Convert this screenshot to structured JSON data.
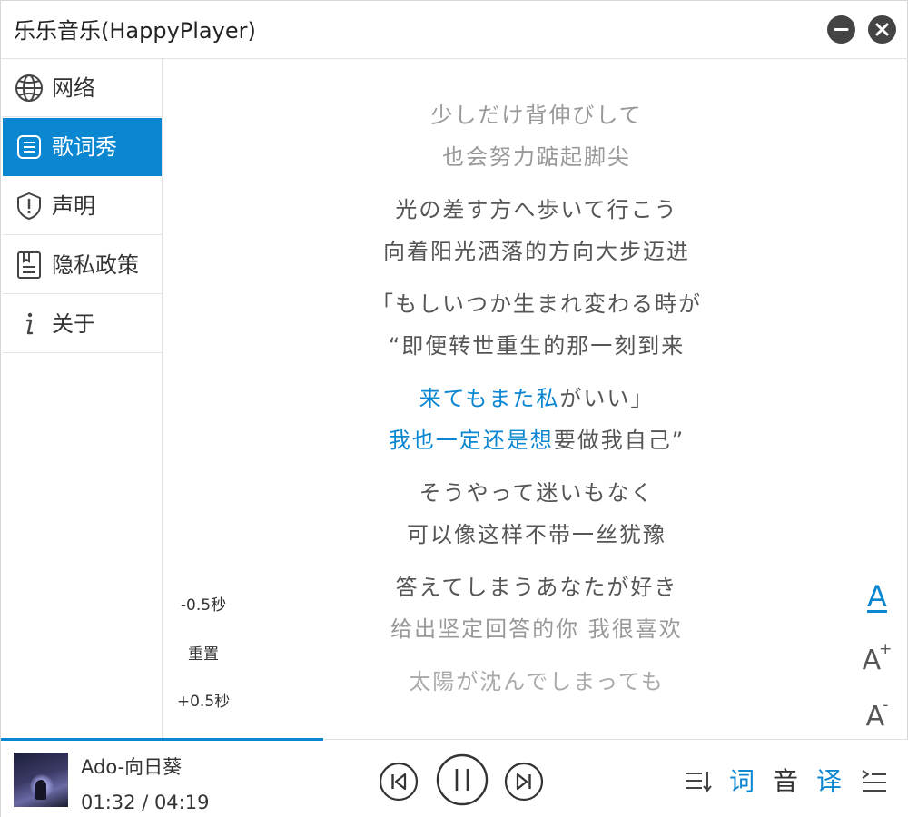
{
  "window": {
    "title": "乐乐音乐(HappyPlayer)"
  },
  "sidebar": {
    "items": [
      {
        "label": "网络",
        "icon": "globe-icon"
      },
      {
        "label": "歌词秀",
        "icon": "lyrics-icon",
        "active": true
      },
      {
        "label": "声明",
        "icon": "shield-icon"
      },
      {
        "label": "隐私政策",
        "icon": "privacy-doc-icon"
      },
      {
        "label": "关于",
        "icon": "info-icon"
      }
    ]
  },
  "offset": {
    "minus": "-0.5秒",
    "reset": "重置",
    "plus": "+0.5秒"
  },
  "lyrics": {
    "lines": [
      {
        "text": "少しだけ背伸びして"
      },
      {
        "text": "也会努力踮起脚尖"
      },
      {
        "text": "光の差す方へ歩いて行こう"
      },
      {
        "text": "向着阳光洒落的方向大步迈进"
      },
      {
        "text": "「もしいつか生まれ変わる時が"
      },
      {
        "text": "“即便转世重生的那一刻到来"
      },
      {
        "played": "来てもまた私",
        "rest": "がいい」"
      },
      {
        "played": "我也一定还是想",
        "rest": "要做我自己”"
      },
      {
        "text": "そうやって迷いもなく"
      },
      {
        "text": "可以像这样不带一丝犹豫"
      },
      {
        "text": "答えてしまうあなたが好き"
      },
      {
        "text": "给出坚定回答的你 我很喜欢"
      },
      {
        "text": "太陽が沈んでしまっても"
      }
    ]
  },
  "font_tools": {
    "color_label": "A",
    "increase_label": "A",
    "increase_mark": "+",
    "decrease_label": "A",
    "decrease_mark": "-"
  },
  "player": {
    "song": "Ado-向日葵",
    "time": "01:32 / 04:19",
    "progress": 0.355
  },
  "toolbar": {
    "lyric_label": "词",
    "audio_label": "音",
    "translate_label": "译"
  },
  "colors": {
    "accent": "#0b86d1"
  }
}
